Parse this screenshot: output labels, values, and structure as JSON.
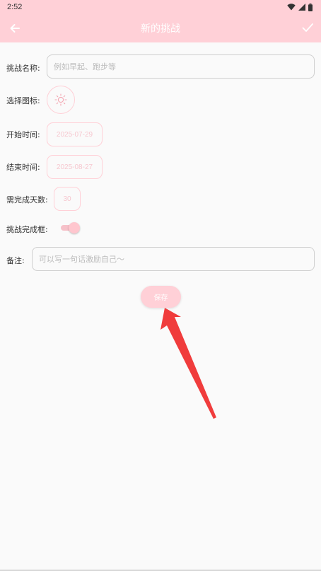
{
  "status": {
    "time": "2:52"
  },
  "appbar": {
    "title": "新的挑战"
  },
  "form": {
    "name_label": "挑战名称:",
    "name_placeholder": "例如早起、跑步等",
    "icon_label": "选择图标:",
    "start_label": "开始时间:",
    "start_value": "2025-07-29",
    "end_label": "结束时间:",
    "end_value": "2025-08-27",
    "days_label": "需完成天数:",
    "days_value": "30",
    "complete_label": "挑战完成框:",
    "complete_toggle_on": true,
    "note_label": "备注:",
    "note_placeholder": "可以写一句话激励自己～"
  },
  "actions": {
    "save_label": "保存"
  },
  "colors": {
    "accent": "#ffd0d7",
    "annotation_arrow": "#f03c3c"
  },
  "icons": {
    "back": "arrow-left-icon",
    "confirm": "check-icon",
    "challenge": "sun-icon"
  }
}
